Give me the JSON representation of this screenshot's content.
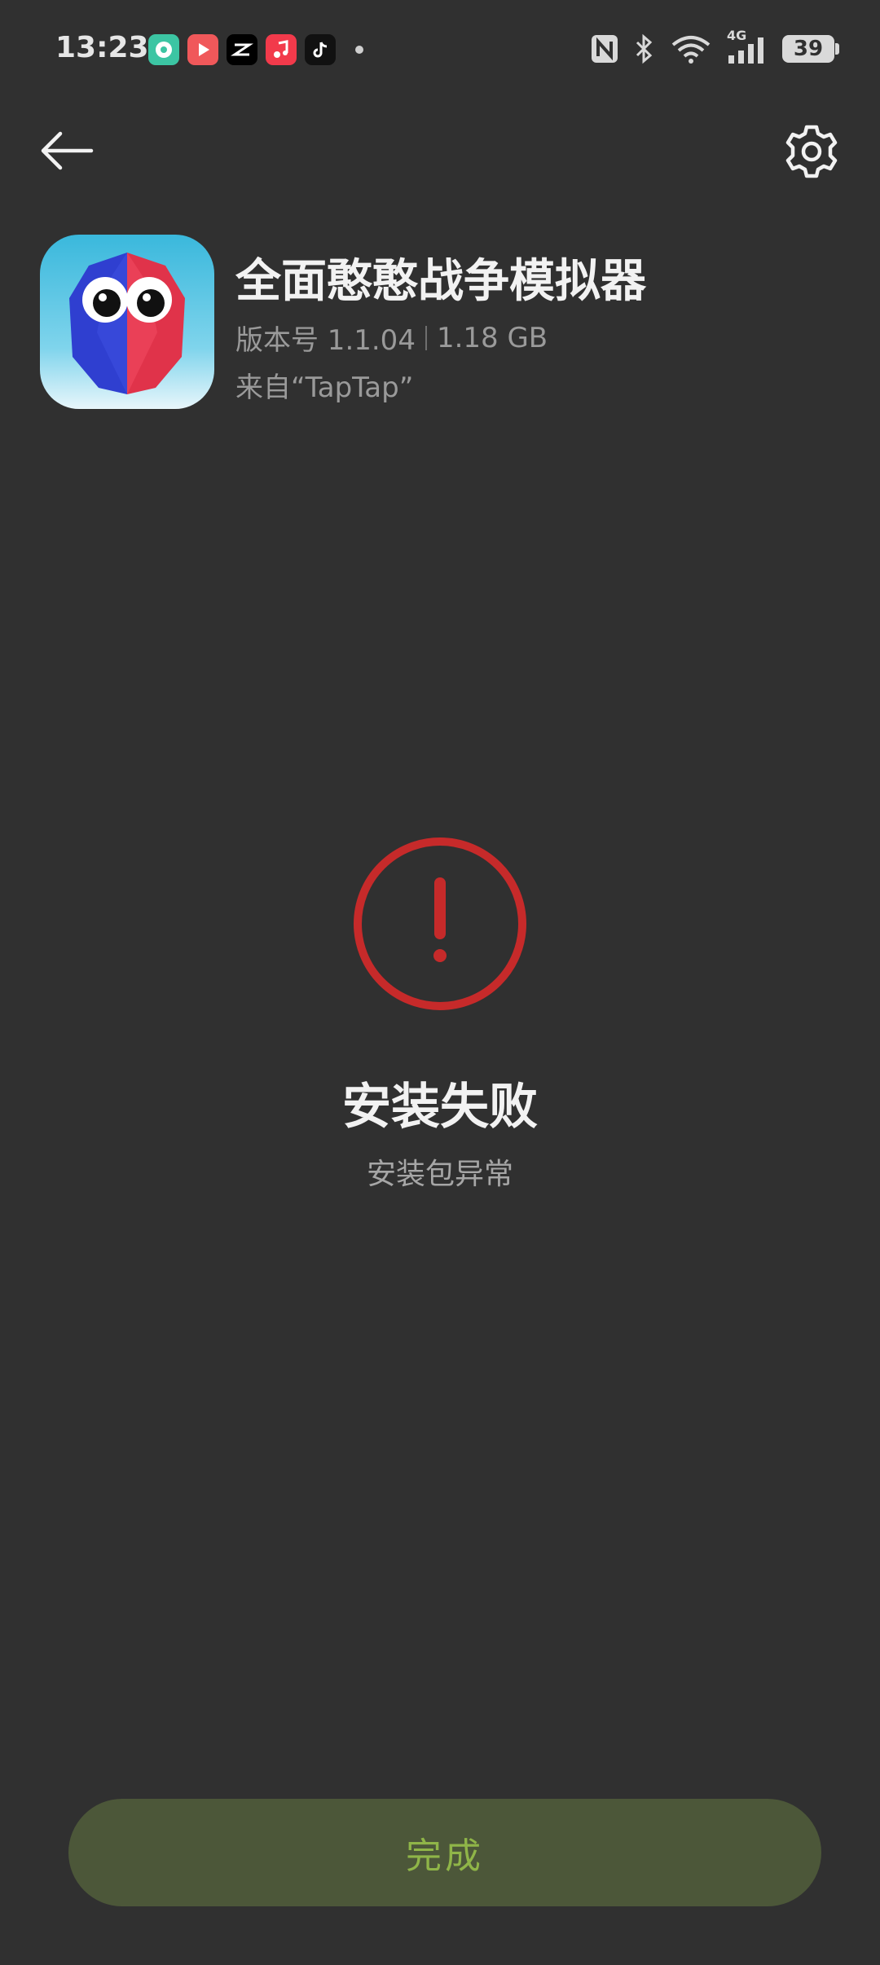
{
  "status_bar": {
    "time": "13:23",
    "battery_level": "39",
    "network_label": "4G",
    "notification_icons": [
      "music-app-icon",
      "video-app-icon",
      "capcut-icon",
      "music-note-icon",
      "tiktok-icon"
    ]
  },
  "header": {
    "back_icon": "arrow-left-icon",
    "settings_icon": "gear-icon"
  },
  "app": {
    "name": "全面憨憨战争模拟器",
    "version": "版本号 1.1.04",
    "size": "1.18 GB",
    "source": "来自“TapTap”"
  },
  "result": {
    "icon": "error-exclamation-icon",
    "title": "安装失败",
    "subtitle": "安装包异常",
    "accent_color": "#c62a2a"
  },
  "footer": {
    "done_label": "完成"
  }
}
